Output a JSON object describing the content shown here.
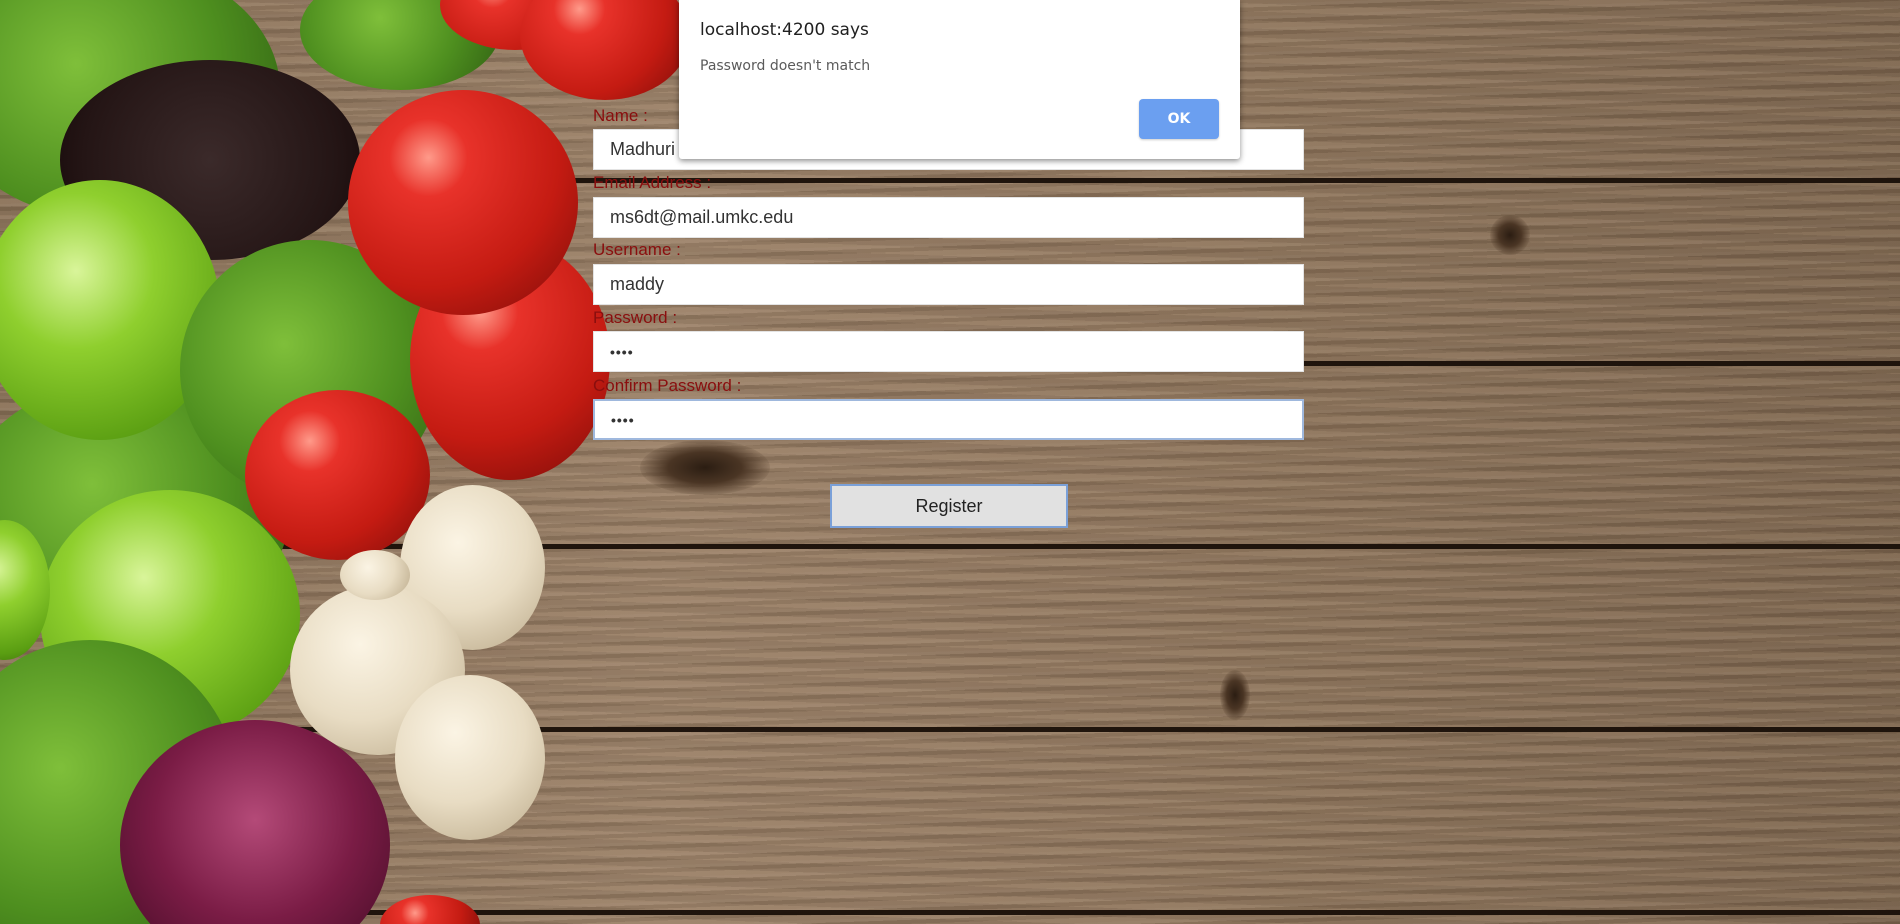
{
  "alert": {
    "title": "localhost:4200 says",
    "message": "Password doesn't match",
    "ok_label": "OK"
  },
  "form": {
    "name_label": "Name :",
    "name_value": "Madhuri",
    "email_label": "Email Address :",
    "email_value": "ms6dt@mail.umkc.edu",
    "username_label": "Username :",
    "username_value": "maddy",
    "password_label": "Password :",
    "password_value": "••••",
    "confirm_label": "Confirm Password :",
    "confirm_value": "••••",
    "register_label": "Register"
  },
  "theme": {
    "label_color": "#8a0e0e",
    "ok_button_color": "#6b9ff0"
  }
}
